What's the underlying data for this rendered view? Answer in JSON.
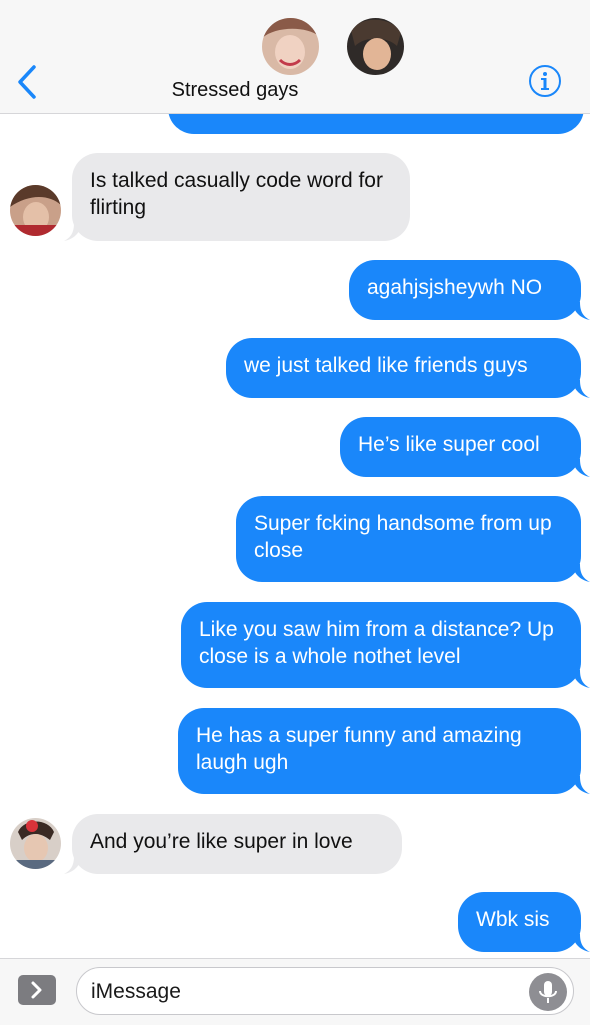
{
  "header": {
    "title": "Stressed gays",
    "back_icon": "chevron-left-icon",
    "info_icon": "info-icon",
    "accent": "#1a87fa"
  },
  "messages": [
    {
      "direction": "outgoing",
      "text": ""
    },
    {
      "direction": "incoming",
      "text": "Is talked casually code word for flirting"
    },
    {
      "direction": "outgoing",
      "text": "agahjsjsheywh NO"
    },
    {
      "direction": "outgoing",
      "text": "we just talked like friends guys"
    },
    {
      "direction": "outgoing",
      "text": "He’s like super cool"
    },
    {
      "direction": "outgoing",
      "text": "Super fcking handsome from up close"
    },
    {
      "direction": "outgoing",
      "text": "Like you saw him from a distance? Up close is a whole nothet level"
    },
    {
      "direction": "outgoing",
      "text": "He has a super funny and amazing laugh ugh"
    },
    {
      "direction": "incoming",
      "text": "And you’re like super in love"
    },
    {
      "direction": "outgoing",
      "text": "Wbk sis"
    }
  ],
  "input": {
    "placeholder": "iMessage",
    "apps_icon": "chevron-right-icon",
    "mic_icon": "microphone-icon"
  },
  "colors": {
    "outgoing_bubble": "#1a87fa",
    "incoming_bubble": "#e9e9eb"
  }
}
